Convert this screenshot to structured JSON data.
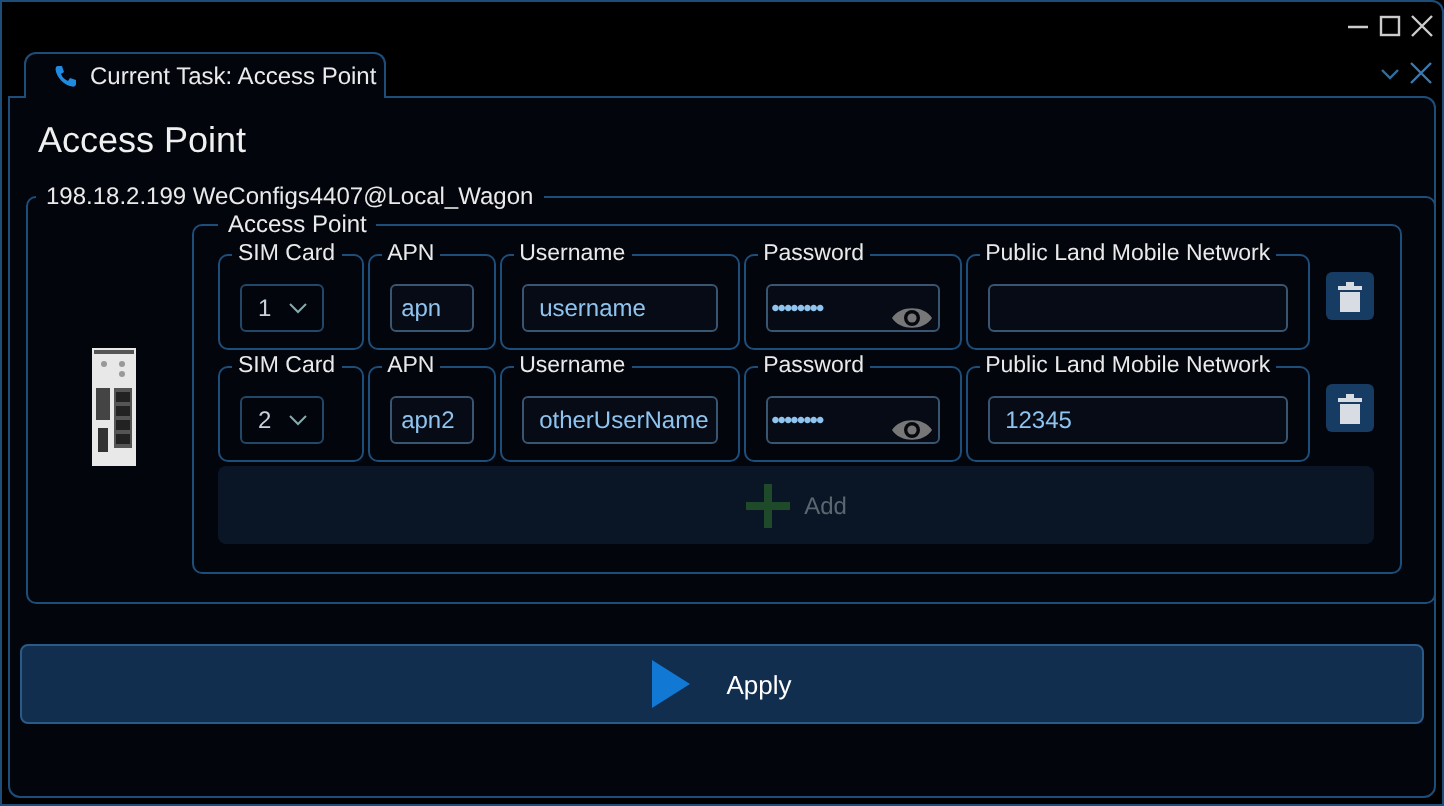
{
  "tab": {
    "label": "Current Task: Access Point",
    "selected": true
  },
  "heading": "Access Point",
  "connection": {
    "legend": "198.18.2.199 WeConfigs4407@Local_Wagon",
    "group": {
      "legend": "Access Point",
      "rows": [
        {
          "sim_label": "SIM Card",
          "sim": "1",
          "apn_label": "APN",
          "apn": "apn",
          "username_label": "Username",
          "username": "username",
          "password_label": "Password",
          "password": "••••••••",
          "plmn_label": "Public Land Mobile Network"
        },
        {
          "sim_label": "SIM Card",
          "sim": "2",
          "apn_label": "APN",
          "apn": "apn2",
          "username_label": "Username",
          "username": "otherUserName",
          "password_label": "Password",
          "password": "••••••••",
          "plmn_label": "Public Land Mobile Network",
          "plmn": "12345"
        }
      ],
      "add": {
        "label": "Add",
        "disabled": true
      }
    }
  },
  "apply": {
    "label": "Apply"
  }
}
